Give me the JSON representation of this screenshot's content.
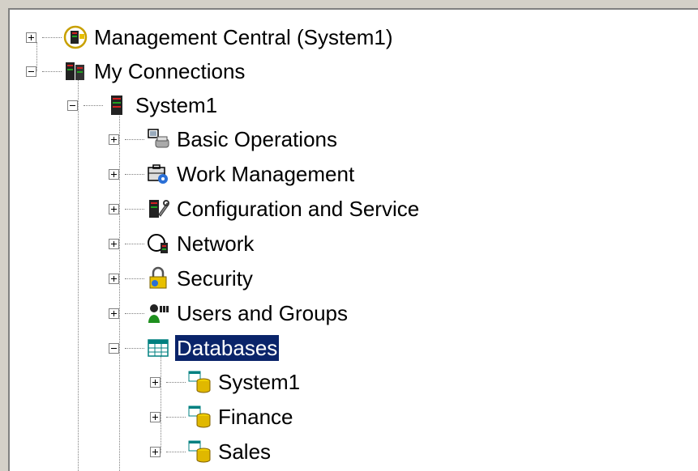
{
  "tree": {
    "nodes": [
      {
        "label": "Management Central (System1)",
        "icon": "management-central-icon",
        "expander": "plus"
      },
      {
        "label": "My Connections",
        "icon": "connections-icon",
        "expander": "minus"
      },
      {
        "label": "System1",
        "icon": "server-icon",
        "expander": "minus"
      },
      {
        "label": "Basic Operations",
        "icon": "basic-operations-icon",
        "expander": "plus"
      },
      {
        "label": "Work Management",
        "icon": "work-management-icon",
        "expander": "plus"
      },
      {
        "label": "Configuration and Service",
        "icon": "configuration-service-icon",
        "expander": "plus"
      },
      {
        "label": "Network",
        "icon": "network-icon",
        "expander": "plus"
      },
      {
        "label": "Security",
        "icon": "security-lock-icon",
        "expander": "plus"
      },
      {
        "label": "Users and Groups",
        "icon": "users-groups-icon",
        "expander": "plus"
      },
      {
        "label": "Databases",
        "icon": "databases-icon",
        "expander": "minus",
        "selected": true
      },
      {
        "label": "System1",
        "icon": "database-cylinder-icon",
        "expander": "plus"
      },
      {
        "label": "Finance",
        "icon": "database-cylinder-icon",
        "expander": "plus"
      },
      {
        "label": "Sales",
        "icon": "database-cylinder-icon",
        "expander": "plus"
      }
    ]
  },
  "colors": {
    "selection": "#0a246a",
    "window": "#d4d0c8"
  }
}
